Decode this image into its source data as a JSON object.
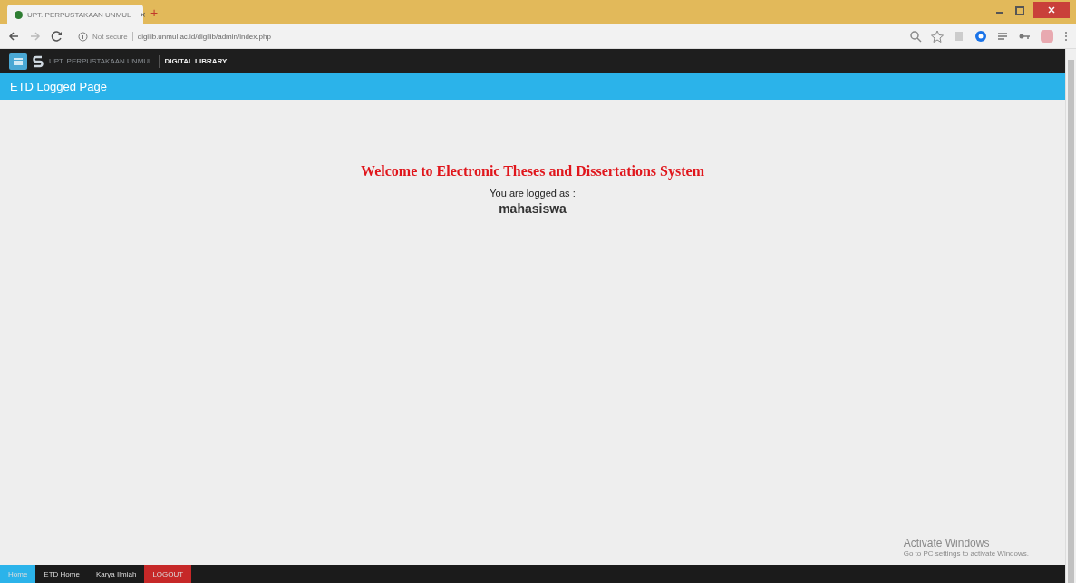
{
  "browser": {
    "tab_title": "UPT. PERPUSTAKAAN UNMUL ·",
    "close_glyph": "×",
    "new_tab_glyph": "+",
    "security": "Not secure",
    "url": "digilib.unmul.ac.id/digilib/admin/index.php"
  },
  "navbar": {
    "brand": "UPT. PERPUSTAKAAN UNMUL",
    "section": "DIGITAL LIBRARY"
  },
  "header": {
    "title": "ETD Logged Page"
  },
  "content": {
    "welcome": "Welcome to Electronic Theses and Dissertations System",
    "logged_label": "You are logged as :",
    "username": "mahasiswa"
  },
  "watermark": {
    "title": "Activate Windows",
    "subtitle": "Go to PC settings to activate Windows."
  },
  "bottom_nav": [
    {
      "label": "Home",
      "selected": true,
      "kind": "link"
    },
    {
      "label": "ETD Home",
      "selected": false,
      "kind": "link"
    },
    {
      "label": "Karya Ilmiah",
      "selected": false,
      "kind": "link"
    },
    {
      "label": "LOGOUT",
      "selected": false,
      "kind": "logout"
    }
  ]
}
